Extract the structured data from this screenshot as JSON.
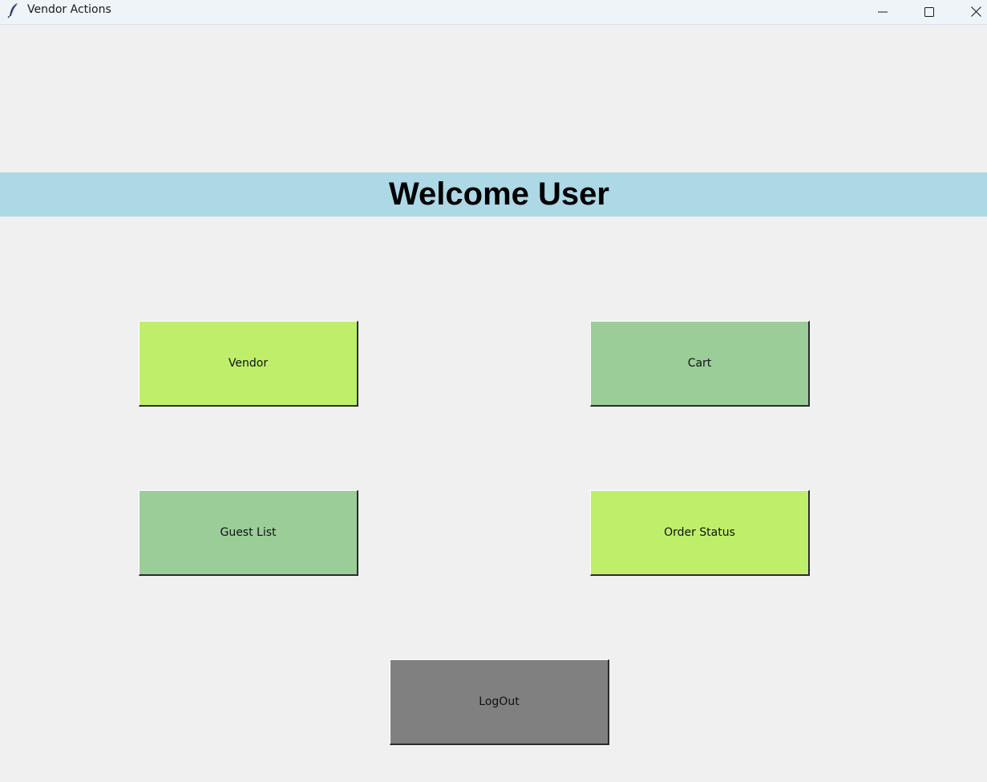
{
  "window": {
    "title": "Vendor Actions",
    "icon": "feather-icon",
    "controls": [
      "minimize-icon",
      "maximize-icon",
      "close-icon"
    ]
  },
  "banner": {
    "title": "Welcome User",
    "background": "#add8e6"
  },
  "buttons": {
    "vendor": {
      "label": "Vendor",
      "color": "#bfef6a"
    },
    "cart": {
      "label": "Cart",
      "color": "#9bcd98"
    },
    "guest_list": {
      "label": "Guest List",
      "color": "#9bcd98"
    },
    "order_status": {
      "label": "Order Status",
      "color": "#bfef6a"
    },
    "logout": {
      "label": "LogOut",
      "color": "#808080"
    }
  }
}
